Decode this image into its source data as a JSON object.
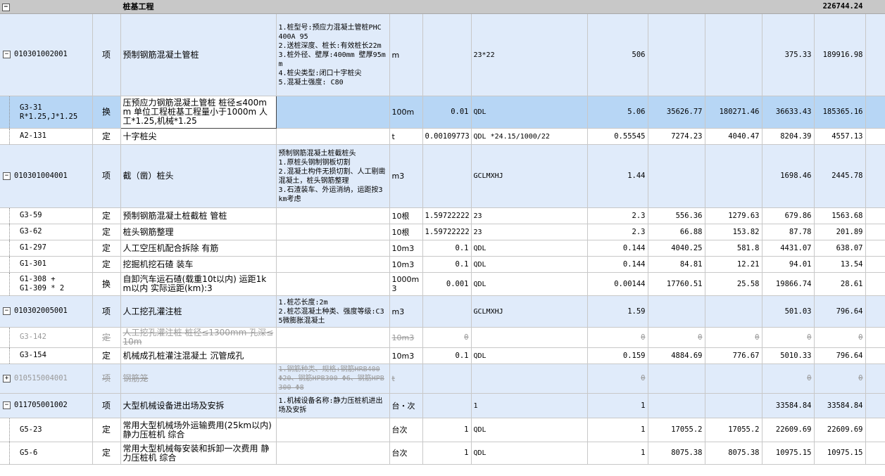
{
  "header": {
    "title": "桩基工程",
    "total": "226744.24",
    "toggle": "−"
  },
  "rows": [
    {
      "code": "010301002001",
      "type": "项",
      "name": "预制钢筋混凝土管桩",
      "feature": "1.桩型号:预应力混凝土管桩PHC 400A 95\n2.送桩深度、桩长:有效桩长22m\n3.桩外径、壁厚:400mm 壁厚95mm\n4.桩尖类型:闭口十字桩尖\n5.混凝土强度: C80",
      "unit": "m",
      "coef": "",
      "expr": "23*22",
      "qty": "506",
      "c1": "",
      "c2": "",
      "price": "375.33",
      "total": "189916.98",
      "toggle": "−"
    },
    {
      "code": "G3-31\nR*1.25,J*1.25",
      "type": "换",
      "name": "压预应力钢筋混凝土管桩 桩径≤400mm 单位工程桩基工程量小于1000m 人工*1.25,机械*1.25",
      "feature": "",
      "unit": "100m",
      "coef": "0.01",
      "expr": "QDL",
      "qty": "5.06",
      "c1": "35626.77",
      "c2": "180271.46",
      "price": "36633.43",
      "total": "185365.16"
    },
    {
      "code": "A2-131",
      "type": "定",
      "name": "十字桩尖",
      "feature": "",
      "unit": "t",
      "coef": "0.00109773",
      "expr": "QDL *24.15/1000/22",
      "qty": "0.55545",
      "c1": "7274.23",
      "c2": "4040.47",
      "price": "8204.39",
      "total": "4557.13"
    },
    {
      "code": "010301004001",
      "type": "项",
      "name": "截（凿）桩头",
      "feature": "预制钢筋混凝土桩截桩头\n1.原桩头钢制钢板切割\n2.混凝土构件无损切割、人工剔凿混凝土，桩头钢筋整理\n3.石渣装车、外运消纳，运距按3km考虑",
      "unit": "m3",
      "coef": "",
      "expr": "GCLMXHJ",
      "qty": "1.44",
      "c1": "",
      "c2": "",
      "price": "1698.46",
      "total": "2445.78",
      "toggle": "−"
    },
    {
      "code": "G3-59",
      "type": "定",
      "name": "预制钢筋混凝土桩截桩 管桩",
      "feature": "",
      "unit": "10根",
      "coef": "1.59722222",
      "expr": "23",
      "qty": "2.3",
      "c1": "556.36",
      "c2": "1279.63",
      "price": "679.86",
      "total": "1563.68"
    },
    {
      "code": "G3-62",
      "type": "定",
      "name": "桩头钢筋整理",
      "feature": "",
      "unit": "10根",
      "coef": "1.59722222",
      "expr": "23",
      "qty": "2.3",
      "c1": "66.88",
      "c2": "153.82",
      "price": "87.78",
      "total": "201.89"
    },
    {
      "code": "G1-297",
      "type": "定",
      "name": "人工空压机配合拆除 有筋",
      "feature": "",
      "unit": "10m3",
      "coef": "0.1",
      "expr": "QDL",
      "qty": "0.144",
      "c1": "4040.25",
      "c2": "581.8",
      "price": "4431.07",
      "total": "638.07"
    },
    {
      "code": "G1-301",
      "type": "定",
      "name": "挖掘机挖石碴 装车",
      "feature": "",
      "unit": "10m3",
      "coef": "0.1",
      "expr": "QDL",
      "qty": "0.144",
      "c1": "84.81",
      "c2": "12.21",
      "price": "94.01",
      "total": "13.54"
    },
    {
      "code": "G1-308 +\nG1-309 * 2",
      "type": "换",
      "name": "自卸汽车运石碴(载重10t以内) 运距1km以内  实际运距(km):3",
      "feature": "",
      "unit": "1000m3",
      "coef": "0.001",
      "expr": "QDL",
      "qty": "0.00144",
      "c1": "17760.51",
      "c2": "25.58",
      "price": "19866.74",
      "total": "28.61"
    },
    {
      "code": "010302005001",
      "type": "项",
      "name": "人工挖孔灌注桩",
      "feature": "1.桩芯长度:2m\n2.桩芯混凝土种类、强度等级:C35微膨胀混凝土",
      "unit": "m3",
      "coef": "",
      "expr": "GCLMXHJ",
      "qty": "1.59",
      "c1": "",
      "c2": "",
      "price": "501.03",
      "total": "796.64",
      "toggle": "−"
    },
    {
      "code": "G3-142",
      "type": "定",
      "name": "人工挖孔灌注桩 桩径≤1300mm 孔深≤10m",
      "feature": "",
      "unit": "10m3",
      "coef": "0",
      "expr": "",
      "qty": "0",
      "c1": "0",
      "c2": "0",
      "price": "0",
      "total": "0"
    },
    {
      "code": "G3-154",
      "type": "定",
      "name": "机械成孔桩灌注混凝土 沉管成孔",
      "feature": "",
      "unit": "10m3",
      "coef": "0.1",
      "expr": "QDL",
      "qty": "0.159",
      "c1": "4884.69",
      "c2": "776.67",
      "price": "5010.33",
      "total": "796.64"
    },
    {
      "code": "010515004001",
      "type": "项",
      "name": "钢筋笼",
      "feature": "1.钢筋种类、规格:钢筋HRB400 Φ20、钢筋HPB300 Φ6、钢筋HPB300 Φ8",
      "unit": "t",
      "coef": "",
      "expr": "",
      "qty": "0",
      "c1": "",
      "c2": "",
      "price": "0",
      "total": "0",
      "toggle": "+"
    },
    {
      "code": "011705001002",
      "type": "项",
      "name": "大型机械设备进出场及安拆",
      "feature": "1.机械设备名称:静力压桩机进出场及安拆",
      "unit": "台・次",
      "coef": "",
      "expr": "1",
      "qty": "1",
      "c1": "",
      "c2": "",
      "price": "33584.84",
      "total": "33584.84",
      "toggle": "−"
    },
    {
      "code": "G5-23",
      "type": "定",
      "name": "常用大型机械场外运输费用(25km以内) 静力压桩机 综合",
      "feature": "",
      "unit": "台次",
      "coef": "1",
      "expr": "QDL",
      "qty": "1",
      "c1": "17055.2",
      "c2": "17055.2",
      "price": "22609.69",
      "total": "22609.69"
    },
    {
      "code": "G5-6",
      "type": "定",
      "name": "常用大型机械每安装和拆卸一次费用 静力压桩机 综合",
      "feature": "",
      "unit": "台次",
      "coef": "1",
      "expr": "QDL",
      "qty": "1",
      "c1": "8075.38",
      "c2": "8075.38",
      "price": "10975.15",
      "total": "10975.15"
    }
  ]
}
